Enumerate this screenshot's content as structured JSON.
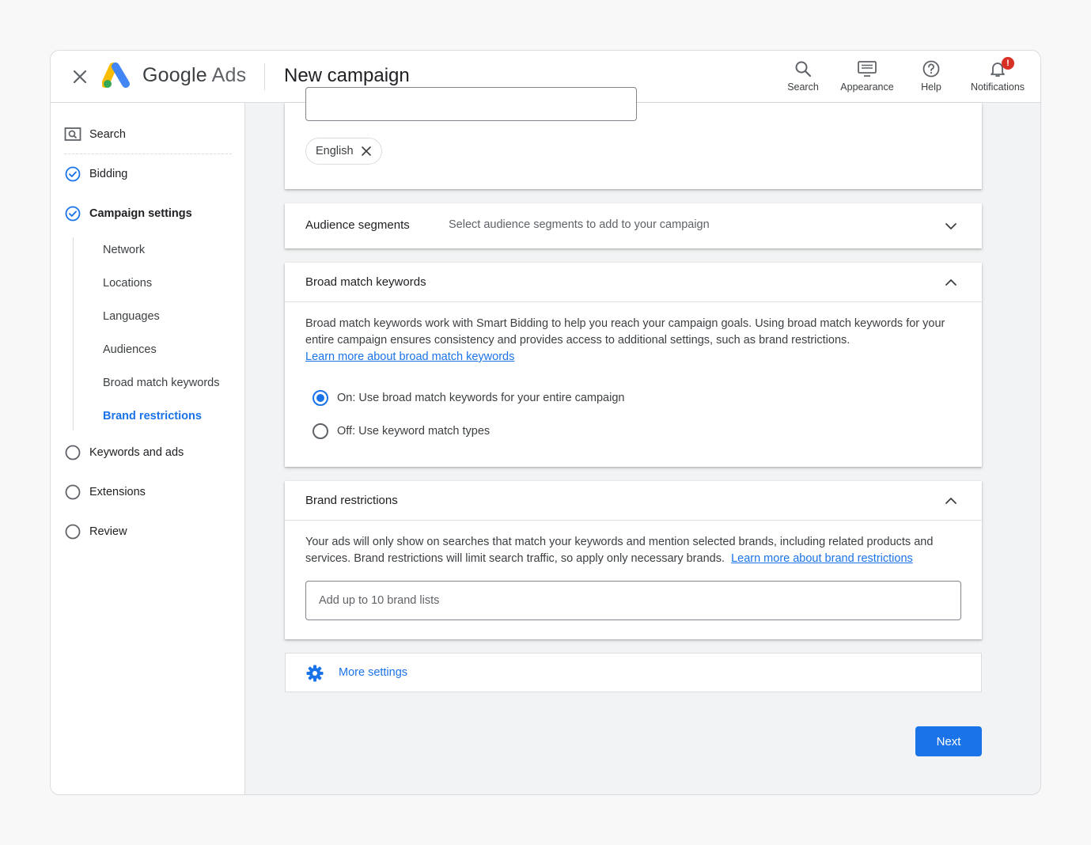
{
  "header": {
    "brand_google": "Google",
    "brand_ads": "Ads",
    "title": "New campaign",
    "tools": [
      {
        "label": "Search",
        "icon": "search-icon"
      },
      {
        "label": "Appearance",
        "icon": "appearance-icon"
      },
      {
        "label": "Help",
        "icon": "help-icon"
      },
      {
        "label": "Notifications",
        "icon": "bell-icon",
        "badge": "!"
      }
    ]
  },
  "sidebar": {
    "campaign_type": {
      "label": "Search",
      "icon": "search-box-icon"
    },
    "steps": [
      {
        "label": "Bidding",
        "status": "complete"
      },
      {
        "label": "Campaign settings",
        "status": "complete"
      },
      {
        "label": "Keywords and ads",
        "status": "pending"
      },
      {
        "label": "Extensions",
        "status": "pending"
      },
      {
        "label": "Review",
        "status": "pending"
      }
    ],
    "sub_items": [
      {
        "label": "Network"
      },
      {
        "label": "Locations"
      },
      {
        "label": "Languages"
      },
      {
        "label": "Audiences"
      },
      {
        "label": "Broad match keywords"
      },
      {
        "label": "Brand restrictions",
        "active": true
      }
    ]
  },
  "languages": {
    "chip": "English"
  },
  "audience": {
    "title": "Audience segments",
    "summary": "Select audience segments to add to your campaign"
  },
  "broad_match": {
    "title": "Broad match keywords",
    "description": "Broad match keywords work with Smart Bidding to help you reach your campaign goals. Using broad match keywords for your entire campaign ensures consistency and provides access to additional settings, such as brand restrictions.",
    "link": "Learn more about broad match keywords",
    "options": [
      {
        "label": "On: Use broad match keywords for your entire campaign",
        "selected": true
      },
      {
        "label": "Off: Use keyword match types",
        "selected": false
      }
    ]
  },
  "brand_restrictions": {
    "title": "Brand restrictions",
    "description": "Your ads will only show on searches that match your keywords and mention selected brands, including related products and services. Brand restrictions will limit search traffic, so apply only necessary brands.",
    "link": "Learn more about brand restrictions",
    "input_placeholder": "Add up to 10 brand lists"
  },
  "more_settings": {
    "label": "More settings"
  },
  "footer": {
    "next_label": "Next"
  },
  "colors": {
    "accent": "#1a73e8",
    "badge": "#d93025"
  }
}
